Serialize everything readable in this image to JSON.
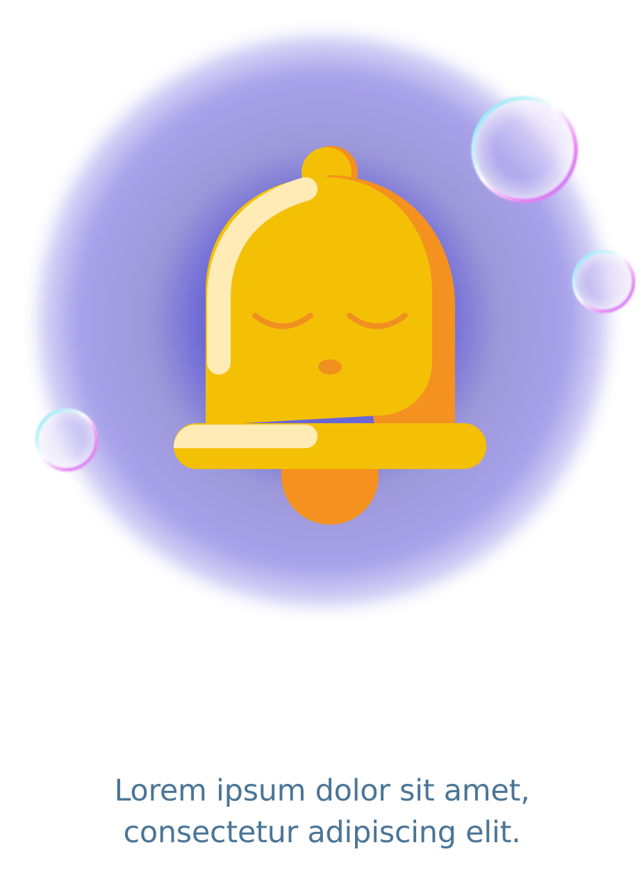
{
  "caption": {
    "line1": "Lorem ipsum dolor sit amet,",
    "line2": "consectetur adipiscing elit."
  },
  "illustration": {
    "subject": "sleeping-bell",
    "colors": {
      "glow": "#6b63d6",
      "glow_outer": "#a9a3ec",
      "bell_body": "#f3c006",
      "bell_shadow": "#f5911f",
      "bell_highlight": "#feebb6",
      "face": "#f0901f"
    }
  }
}
